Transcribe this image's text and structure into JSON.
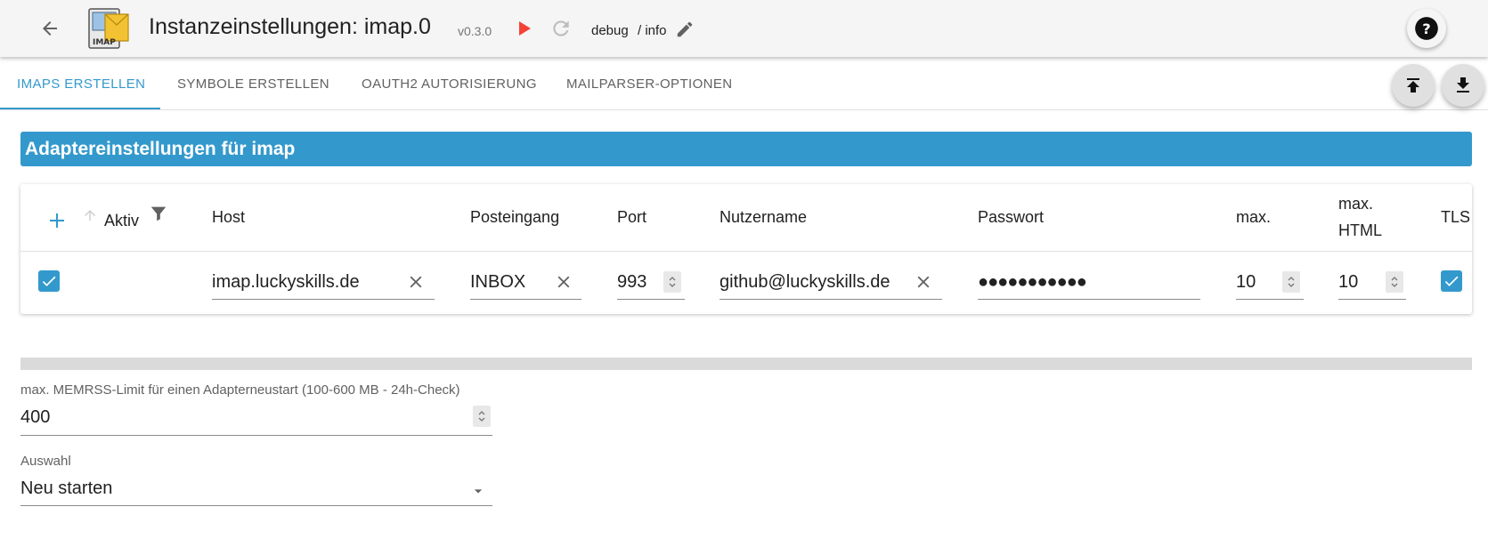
{
  "header": {
    "title": "Instanzeinstellungen: imap.0",
    "version": "v0.3.0",
    "loglevel": "debug",
    "loglevel_info": "/ info",
    "logo_text": "IMAP",
    "play_color": "#f44336"
  },
  "tabs": [
    {
      "label": "IMAPS ERSTELLEN",
      "active": true
    },
    {
      "label": "SYMBOLE ERSTELLEN",
      "active": false
    },
    {
      "label": "OAUTH2 AUTORISIERUNG",
      "active": false
    },
    {
      "label": "MAILPARSER-OPTIONEN",
      "active": false
    }
  ],
  "section": {
    "title": "Adaptereinstellungen für imap",
    "color": "#3399cc"
  },
  "table": {
    "columns": {
      "active": "Aktiv",
      "host": "Host",
      "inbox": "Posteingang",
      "port": "Port",
      "username": "Nutzername",
      "password": "Passwort",
      "max": "max.",
      "max_html_1": "max.",
      "max_html_2": "HTML",
      "tls": "TLS"
    },
    "rows": [
      {
        "active": true,
        "host": "imap.luckyskills.de",
        "inbox": "INBOX",
        "port": "993",
        "username": "github@luckyskills.de",
        "password": "●●●●●●●●●●●",
        "max": "10",
        "max_html": "10",
        "tls": true
      }
    ]
  },
  "memrss": {
    "label": "max. MEMRSS-Limit für einen Adapterneustart (100-600 MB - 24h-Check)",
    "value": "400"
  },
  "auswahl": {
    "label": "Auswahl",
    "value": "Neu starten"
  }
}
